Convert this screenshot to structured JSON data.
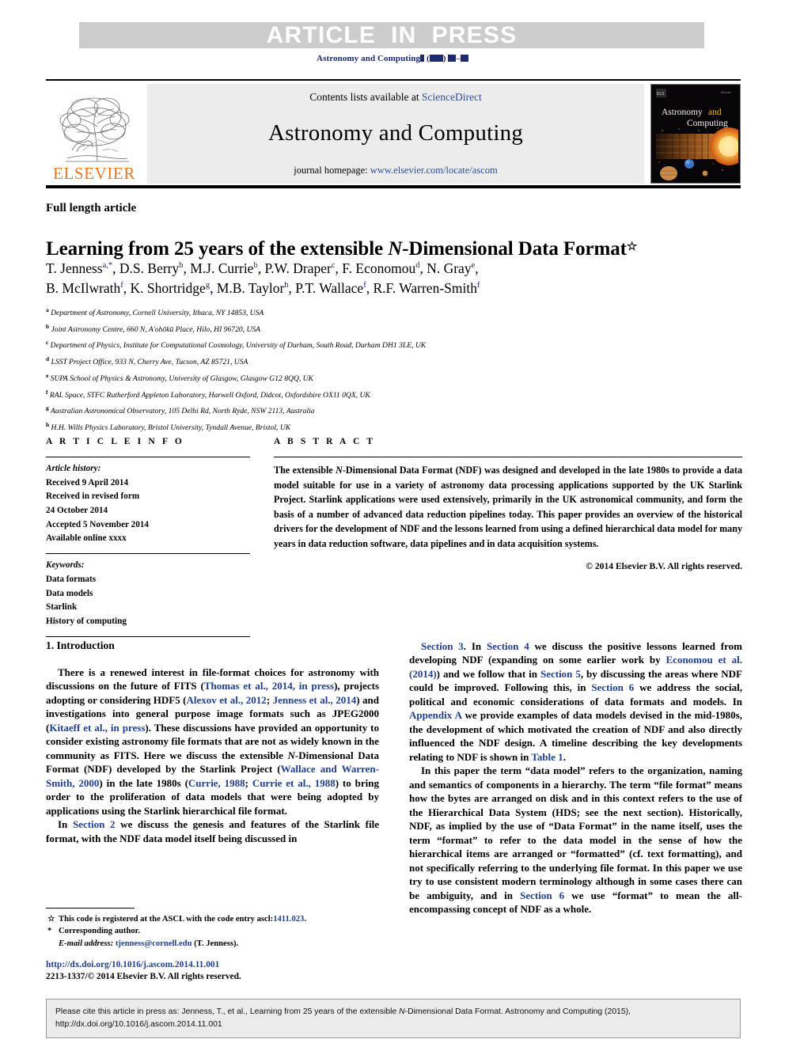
{
  "banner": {
    "text": "ARTICLE  IN  PRESS",
    "background_color": "#cccccc",
    "text_color": "#ffffff"
  },
  "journal_ref": {
    "journal": "Astronomy and Computing",
    "volume_placeholder": "▮",
    "year_placeholder": "▮▮▮▮",
    "pages_placeholder": "▮▮–▮▮",
    "color": "#1a2a6c"
  },
  "masthead": {
    "publisher": "ELSEVIER",
    "publisher_color": "#e87722",
    "contents_prefix": "Contents lists available at ",
    "contents_link": "ScienceDirect",
    "journal_title": "Astronomy and Computing",
    "homepage_prefix": "journal homepage: ",
    "homepage_url": "www.elsevier.com/locate/ascom",
    "link_color": "#2b4c9b",
    "cover": {
      "title_line1_a": "Astronomy",
      "title_line1_b": "and",
      "title_line2": "Computing",
      "corner_label": "Elsevier"
    }
  },
  "article": {
    "type_label": "Full length article",
    "title": "Learning from 25 years of the extensible N-Dimensional Data Format",
    "title_italic_part": "N",
    "title_footnote_mark": "☆",
    "authors": [
      {
        "name": "T. Jenness",
        "marks": "a,*"
      },
      {
        "name": "D.S. Berry",
        "marks": "b"
      },
      {
        "name": "M.J. Currie",
        "marks": "b"
      },
      {
        "name": "P.W. Draper",
        "marks": "c"
      },
      {
        "name": "F. Economou",
        "marks": "d"
      },
      {
        "name": "N. Gray",
        "marks": "e"
      },
      {
        "name": "B. McIlwrath",
        "marks": "f"
      },
      {
        "name": "K. Shortridge",
        "marks": "g"
      },
      {
        "name": "M.B. Taylor",
        "marks": "h"
      },
      {
        "name": "P.T. Wallace",
        "marks": "f"
      },
      {
        "name": "R.F. Warren-Smith",
        "marks": "f"
      }
    ],
    "affiliations": [
      {
        "mark": "a",
        "text": "Department of Astronomy, Cornell University, Ithaca, NY 14853, USA"
      },
      {
        "mark": "b",
        "text": "Joint Astronomy Centre, 660 N, A'ohōkū Place, Hilo, HI 96720, USA"
      },
      {
        "mark": "c",
        "text": "Department of Physics, Institute for Computational Cosmology, University of Durham, South Road, Durham DH1 3LE, UK"
      },
      {
        "mark": "d",
        "text": "LSST Project Office, 933 N, Cherry Ave, Tucson, AZ 85721, USA"
      },
      {
        "mark": "e",
        "text": "SUPA School of Physics & Astronomy, University of Glasgow, Glasgow G12 8QQ, UK"
      },
      {
        "mark": "f",
        "text": "RAL Space, STFC Rutherford Appleton Laboratory, Harwell Oxford, Didcot, Oxfordshire OX11 0QX, UK"
      },
      {
        "mark": "g",
        "text": "Australian Astronomical Observatory, 105 Delhi Rd, North Ryde, NSW 2113, Australia"
      },
      {
        "mark": "h",
        "text": "H.H. Wills Physics Laboratory, Bristol University, Tyndall Avenue, Bristol, UK"
      }
    ]
  },
  "article_info": {
    "heading": "A R T I C L E    I N F O",
    "history_label": "Article history:",
    "history_lines": [
      "Received 9 April 2014",
      "Received in revised form",
      "24 October 2014",
      "Accepted 5 November 2014",
      "Available online xxxx"
    ],
    "keywords_label": "Keywords:",
    "keywords": [
      "Data formats",
      "Data models",
      "Starlink",
      "History of computing"
    ]
  },
  "abstract": {
    "heading": "A B S T R A C T",
    "text": "The extensible N-Dimensional Data Format (NDF) was designed and developed in the late 1980s to provide a data model suitable for use in a variety of astronomy data processing applications supported by the UK Starlink Project. Starlink applications were used extensively, primarily in the UK astronomical community, and form the basis of a number of advanced data reduction pipelines today. This paper provides an overview of the historical drivers for the development of NDF and the lessons learned from using a defined hierarchical data model for many years in data reduction software, data pipelines and in data acquisition systems.",
    "copyright": "© 2014 Elsevier B.V. All rights reserved."
  },
  "body": {
    "section_heading": "1.  Introduction",
    "left_paragraphs": [
      "There is a renewed interest in file-format choices for astronomy with discussions on the future of FITS (Thomas et al., 2014, in press), projects adopting or considering HDF5 (Alexov et al., 2012; Jenness et al., 2014) and investigations into general purpose image formats such as JPEG2000 (Kitaeff et al., in press). These discussions have provided an opportunity to consider existing astronomy file formats that are not as widely known in the community as FITS. Here we discuss the extensible N-Dimensional Data Format (NDF) developed by the Starlink Project (Wallace and Warren-Smith, 2000) in the late 1980s (Currie, 1988; Currie et al., 1988) to bring order to the proliferation of data models that were being adopted by applications using the Starlink hierarchical file format.",
      "In Section 2 we discuss the genesis and features of the Starlink file format, with the NDF data model itself being discussed in"
    ],
    "right_paragraphs": [
      "Section 3. In Section 4 we discuss the positive lessons learned from developing NDF (expanding on some earlier work by Economou et al. (2014)) and we follow that in Section 5, by discussing the areas where NDF could be improved. Following this, in Section 6 we address the social, political and economic considerations of data formats and models. In Appendix A we provide examples of data models devised in the mid-1980s, the development of which motivated the creation of NDF and also directly influenced the NDF design. A timeline describing the key developments relating to NDF is shown in Table 1.",
      "In this paper the term “data model” refers to the organization, naming and semantics of components in a hierarchy. The term “file format” means how the bytes are arranged on disk and in this context refers to the use of the Hierarchical Data System (HDS; see the next section). Historically, NDF, as implied by the use of “Data Format” in the name itself, uses the term “format” to refer to the data model in the sense of how the hierarchical items are arranged or “formatted” (cf. text formatting), and not specifically referring to the underlying file format. In this paper we use try to use consistent modern terminology although in some cases there can be ambiguity, and in Section 6 we use “format” to mean the all-encompassing concept of NDF as a whole."
    ],
    "link_color": "#20408f"
  },
  "footnotes": {
    "star_mark": "☆",
    "star_text_prefix": "This code is registered at the ASCL with the code entry ascl:",
    "star_text_link": "1411.023",
    "star_text_suffix": ".",
    "asterisk_mark": "*",
    "corresponding_text": "Corresponding author.",
    "email_label": "E-mail address:",
    "email_address": "tjenness@cornell.edu",
    "email_owner": "(T. Jenness).",
    "doi_url": "http://dx.doi.org/10.1016/j.ascom.2014.11.001",
    "issn_line": "2213-1337/© 2014 Elsevier B.V. All rights reserved."
  },
  "cite_box": {
    "line1": "Please cite this article in press as: Jenness, T., et al., Learning from 25 years of the extensible N-Dimensional Data Format. Astronomy and Computing (2015),",
    "line2": "http://dx.doi.org/10.1016/j.ascom.2014.11.001"
  }
}
